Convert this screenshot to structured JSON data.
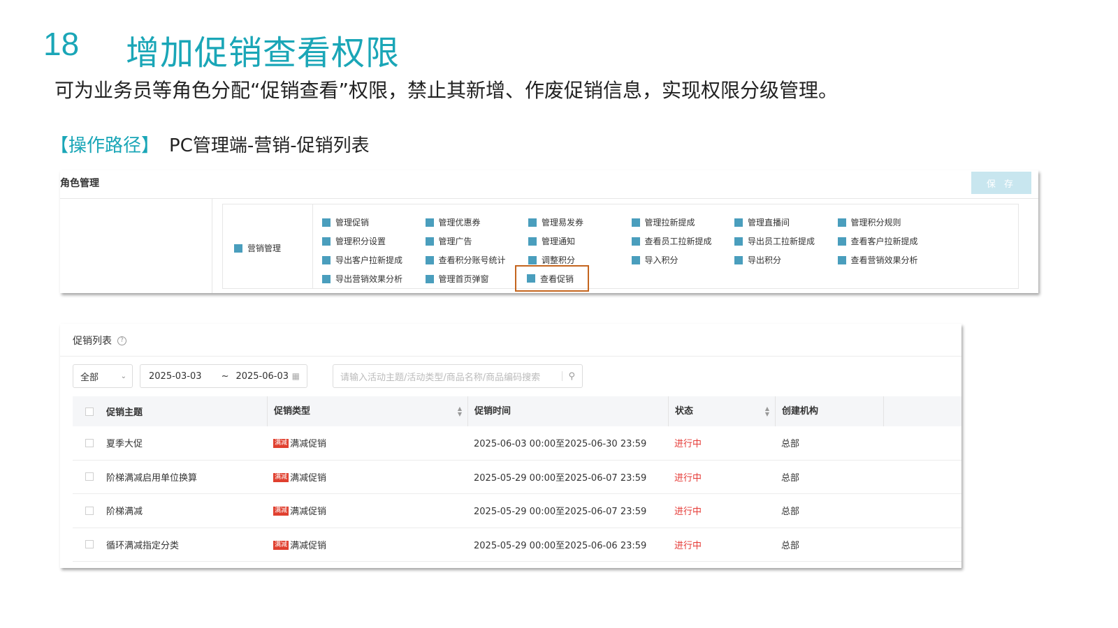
{
  "slide": {
    "number": "18",
    "title": "增加促销查看权限",
    "description": "可为业务员等角色分配“促销查看”权限，禁止其新增、作废促销信息，实现权限分级管理。",
    "path_label": "【操作路径】",
    "path_text": "PC管理端-营销-促销列表"
  },
  "role_panel": {
    "title": "角色管理",
    "save_label": "保 存",
    "group_label": "营销管理",
    "permissions": [
      "管理促销",
      "管理优惠券",
      "管理易发券",
      "管理拉新提成",
      "管理直播间",
      "管理积分规则",
      "管理积分设置",
      "管理广告",
      "管理通知",
      "查看员工拉新提成",
      "导出员工拉新提成",
      "查看客户拉新提成",
      "导出客户拉新提成",
      "查看积分账号统计",
      "调整积分",
      "导入积分",
      "导出积分",
      "查看营销效果分析",
      "导出营销效果分析",
      "管理首页弹窗",
      "查看促销"
    ],
    "checkbox_color": "#4a9ebd",
    "highlight_color": "#c4651e"
  },
  "promo_panel": {
    "title": "促销列表",
    "help_icon": "question-circle-icon",
    "filter": {
      "select_value": "全部",
      "date_start": "2025-03-03",
      "date_sep": "~",
      "date_end": "2025-06-03",
      "search_placeholder": "请输入活动主题/活动类型/商品名称/商品编码搜索"
    },
    "columns": [
      "促销主题",
      "促销类型",
      "促销时间",
      "状态",
      "创建机构"
    ],
    "rows": [
      {
        "subject": "夏季大促",
        "tag": "满减",
        "type": "满减促销",
        "time": "2025-06-03 00:00至2025-06-30 23:59",
        "status": "进行中",
        "org": "总部"
      },
      {
        "subject": "阶梯满减启用单位换算",
        "tag": "满减",
        "type": "满减促销",
        "time": "2025-05-29 00:00至2025-06-07 23:59",
        "status": "进行中",
        "org": "总部"
      },
      {
        "subject": "阶梯满减",
        "tag": "满减",
        "type": "满减促销",
        "time": "2025-05-29 00:00至2025-06-07 23:59",
        "status": "进行中",
        "org": "总部"
      },
      {
        "subject": "循环满减指定分类",
        "tag": "满减",
        "type": "满减促销",
        "time": "2025-05-29 00:00至2025-06-06 23:59",
        "status": "进行中",
        "org": "总部"
      }
    ],
    "status_color": "#e53935",
    "tag_color": "#e0402f"
  },
  "accent_color": "#1aa6b7"
}
